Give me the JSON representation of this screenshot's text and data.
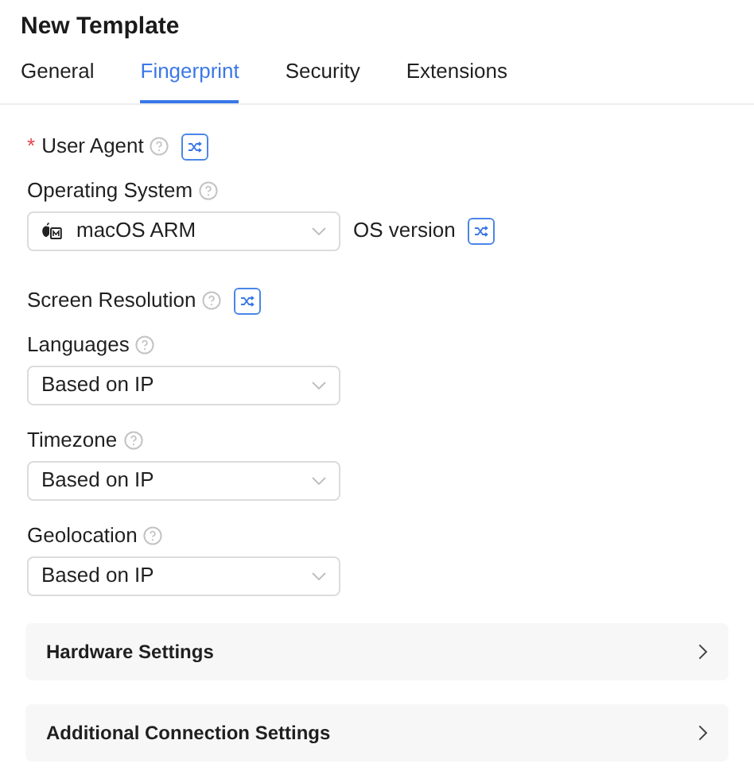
{
  "title": "New Template",
  "tabs": [
    {
      "label": "General",
      "selected": false
    },
    {
      "label": "Fingerprint",
      "selected": true
    },
    {
      "label": "Security",
      "selected": false
    },
    {
      "label": "Extensions",
      "selected": false
    }
  ],
  "fields": [
    {
      "kind": "shuffle",
      "label": "User Agent",
      "required_mark": "*"
    },
    {
      "kind": "select",
      "label": "Operating System",
      "value": "macOS ARM",
      "os_icon": true,
      "extra_label": "OS version"
    },
    {
      "kind": "shuffle",
      "label": "Screen Resolution"
    },
    {
      "kind": "select",
      "label": "Languages",
      "value": "Based on IP"
    },
    {
      "kind": "select",
      "label": "Timezone",
      "value": "Based on IP"
    },
    {
      "kind": "select",
      "label": "Geolocation",
      "value": "Based on IP"
    }
  ],
  "sections": [
    {
      "label": "Hardware Settings",
      "expanded": false
    },
    {
      "label": "Additional Connection Settings",
      "expanded": false
    }
  ]
}
